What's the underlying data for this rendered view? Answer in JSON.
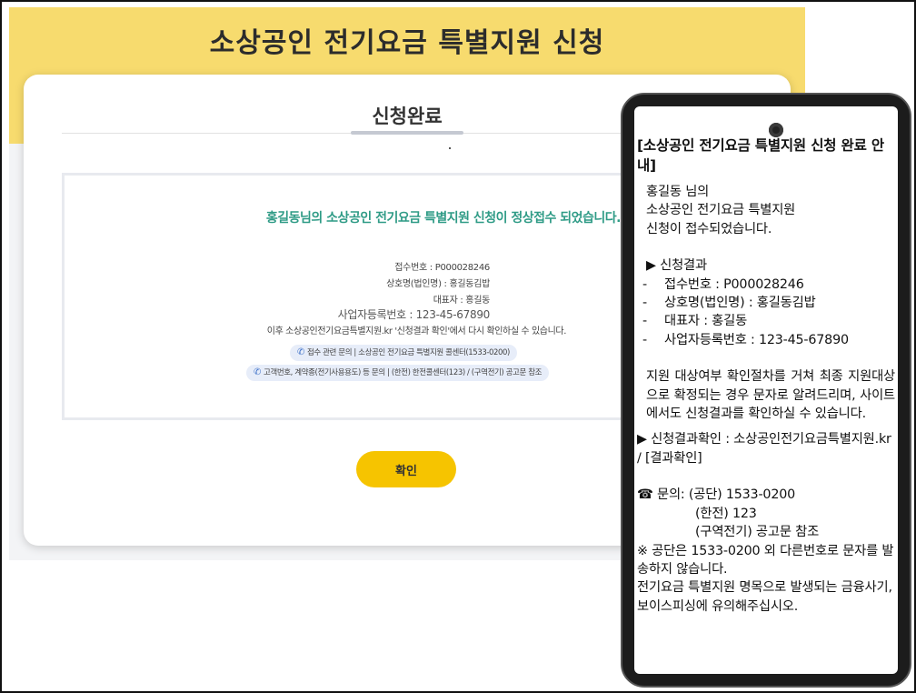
{
  "web": {
    "banner_title": "소상공인 전기요금 특별지원 신청",
    "card_title": "신청완료",
    "headline": "홍길동님의 소상공인 전기요금 특별지원 신청이 정상접수 되었습니다.",
    "receipt_number": "접수번호 : P000028246",
    "business_name": "상호명(법인명) : 홍길동김밥",
    "representative": "대표자 : 홍길동",
    "business_reg_number": "사업자등록번호 : 123-45-67890",
    "followup_note": "이후 소상공인전기요금특별지원.kr '신청결과 확인'에서 다시 확인하실 수 있습니다.",
    "contact_pill_1": "접수 관련 문의 | 소상공인 전기요금 특별지원 콜센터(1533-0200)",
    "contact_pill_2": "고객번호, 계약종(전기사용용도) 등 문의 | (한전) 한전콜센터(123) / (구역전기) 공고문 참조",
    "phone_icon": "phone-icon",
    "confirm_label": "확인",
    "accent_yellow": "#f7db6e",
    "button_yellow": "#f6c400",
    "headline_green": "#2f9b86"
  },
  "sms": {
    "title": "[소상공인 전기요금 특별지원 신청 완료 안내]",
    "greeting_1": "홍길동 님의",
    "greeting_2": "소상공인 전기요금 특별지원",
    "greeting_3": "신청이 접수되었습니다.",
    "result_heading": "▶ 신청결과",
    "items": [
      {
        "dash": "-",
        "text": "접수번호 : P000028246"
      },
      {
        "dash": "-",
        "text": "상호명(법인명) : 홍길동김밥"
      },
      {
        "dash": "-",
        "text": "대표자 : 홍길동"
      },
      {
        "dash": "-",
        "text": "사업자등록번호 : 123-45-67890"
      }
    ],
    "notice": "지원 대상여부 확인절차를 거쳐 최종 지원대상으로 확정되는 경우 문자로 알려드리며, 사이트에서도 신청결과를 확인하실 수 있습니다.",
    "check_line": "▶ 신청결과확인 : 소상공인전기요금특별지원.kr / [결과확인]",
    "inquiry_icon": "☎",
    "inquiry_1": "문의: (공단) 1533-0200",
    "inquiry_2": "(한전) 123",
    "inquiry_3": "(구역전기) 공고문 참조",
    "warning": "※ 공단은 1533-0200 외 다른번호로 문자를 발송하지 않습니다.",
    "warning_2": "전기요금 특별지원 명목으로 발생되는 금융사기, 보이스피싱에 유의해주십시오."
  }
}
